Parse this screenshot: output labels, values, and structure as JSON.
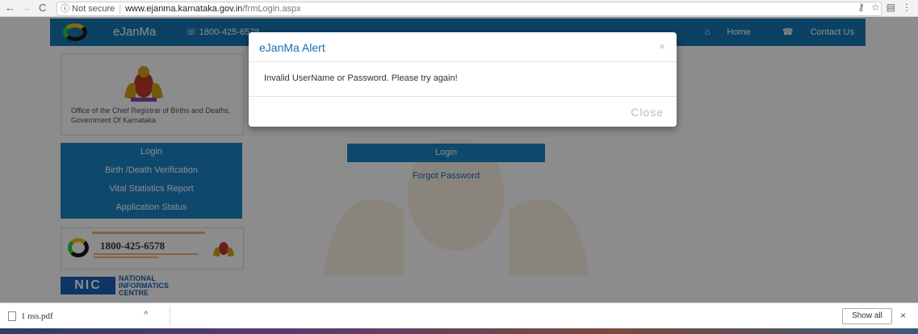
{
  "browser": {
    "back": "←",
    "forward": "→",
    "reload": "C",
    "security": "ⓘ Not secure",
    "domain": "www.ejanma.karnataka.gov.in",
    "path": "/frmLogin.aspx",
    "icons": [
      "key-icon",
      "star-icon",
      "extension-icon",
      "menu-icon"
    ]
  },
  "header": {
    "brand": "eJanMa",
    "phone": "☏ 1800-425-6578",
    "home": "Home",
    "contact": "Contact Us"
  },
  "sidebar": {
    "office": "Office of the Chief Registrar of Births and Deaths, Government Of Karnataka",
    "menu": [
      "Login",
      "Birth /Death Verification",
      "Vital Statistics Report",
      "Application Status"
    ]
  },
  "helpline": {
    "number": "1800-425-6578"
  },
  "nic": {
    "abbr": "NIC",
    "name": "NATIONAL INFORMATICS CENTRE"
  },
  "form": {
    "login_button": "Login",
    "forgot": "Forgot Password"
  },
  "modal": {
    "title": "eJanMa Alert",
    "close_x": "×",
    "message": "Invalid UserName or Password. Please try again!",
    "close_button": "Close"
  },
  "downloads": {
    "file": "1 nss.pdf",
    "chevron": "^",
    "show_all": "Show all",
    "close": "×"
  },
  "colors": {
    "header_blue": "#1478b7",
    "menu_blue": "#1b86c7",
    "link_blue": "#1b6eb0"
  }
}
